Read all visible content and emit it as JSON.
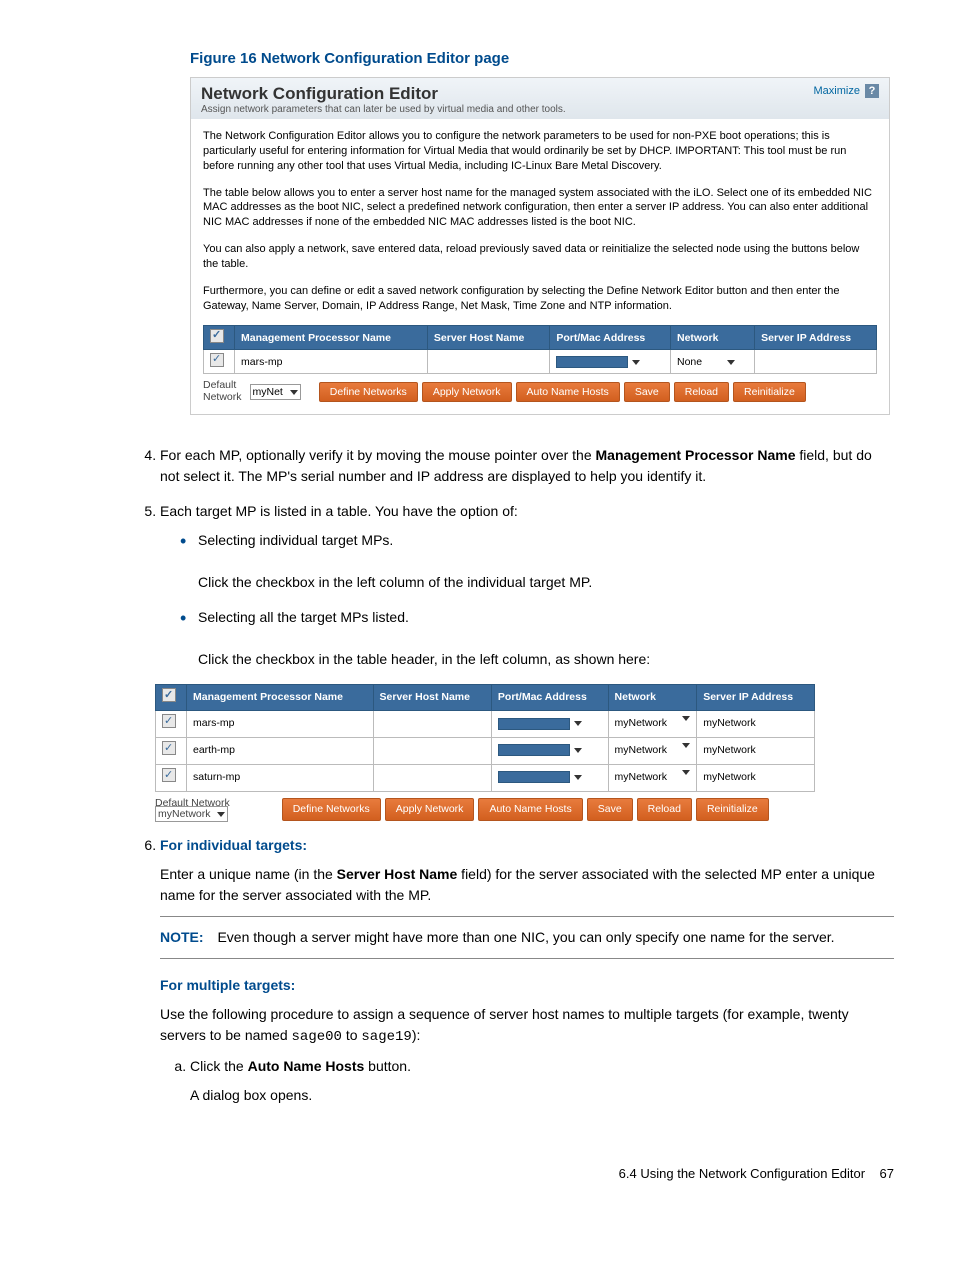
{
  "figure_title": "Figure 16 Network Configuration Editor page",
  "ss1": {
    "title": "Network Configuration Editor",
    "subtitle": "Assign network parameters that can later be used by virtual media and other tools.",
    "maximize": "Maximize",
    "p1": "The Network Configuration Editor allows you to configure the network parameters to be used for non-PXE boot operations; this is particularly useful for entering information for Virtual Media that would ordinarily be set by DHCP. IMPORTANT: This tool must be run before running any other tool that uses Virtual Media, including IC-Linux Bare Metal Discovery.",
    "p2": "The table below allows you to enter a server host name for the managed system associated with the iLO. Select one of its embedded NIC MAC addresses as the boot NIC, select a predefined network configuration, then enter a server IP address. You can also enter additional NIC MAC addresses if none of the embedded NIC MAC addresses listed is the boot NIC.",
    "p3": "You can also apply a network, save entered data, reload previously saved data or reinitialize the selected node using the buttons below the table.",
    "p4": "Furthermore, you can define or edit a saved network configuration by selecting the Define Network Editor button and then enter the Gateway, Name Server, Domain, IP Address Range, Net Mask, Time Zone and NTP information.",
    "headers": [
      "Management Processor Name",
      "Server Host Name",
      "Port/Mac Address",
      "Network",
      "Server IP Address"
    ],
    "row1_name": "mars-mp",
    "row1_network": "None",
    "default_network_label": "Default\nNetwork",
    "default_network_value": "myNet",
    "buttons": [
      "Define Networks",
      "Apply Network",
      "Auto Name Hosts",
      "Save",
      "Reload",
      "Reinitialize"
    ]
  },
  "step4": {
    "pre": "For each MP, optionally verify it by moving the mouse pointer over the ",
    "bold": "Management Processor Name",
    "post": " field, but do not select it. The MP's serial number and IP address are displayed to help you identify it."
  },
  "step5": {
    "intro": "Each target MP is listed in a table. You have the option of:",
    "b1a": "Selecting individual target MPs.",
    "b1b": "Click the checkbox in the left column of the individual target MP.",
    "b2a": "Selecting all the target MPs listed.",
    "b2b": "Click the checkbox in the table header, in the left column, as shown here:"
  },
  "ss2": {
    "headers": [
      "Management Processor Name",
      "Server Host Name",
      "Port/Mac Address",
      "Network",
      "Server IP Address"
    ],
    "rows": [
      {
        "name": "mars-mp",
        "net": "myNetwork",
        "ip": "myNetwork"
      },
      {
        "name": "earth-mp",
        "net": "myNetwork",
        "ip": "myNetwork"
      },
      {
        "name": "saturn-mp",
        "net": "myNetwork",
        "ip": "myNetwork"
      }
    ],
    "default_network_label": "Default Network",
    "default_network_value": "myNetwork",
    "buttons": [
      "Define Networks",
      "Apply Network",
      "Auto Name Hosts",
      "Save",
      "Reload",
      "Reinitialize"
    ]
  },
  "step6": {
    "h1": "For individual targets:",
    "p1a": "Enter a unique name (in the ",
    "p1b": "Server Host Name",
    "p1c": " field) for the server associated with the selected MP enter a unique name for the server associated with the MP.",
    "note_label": "NOTE:",
    "note": "Even though a server might have more than one NIC, you can only specify one name for the server.",
    "h2": "For multiple targets:",
    "p2a": "Use the following procedure to assign a sequence of server host names to multiple targets (for example, twenty servers to be named ",
    "p2b": "sage00",
    "p2c": " to ",
    "p2d": "sage19",
    "p2e": "):",
    "a1a": "Click the ",
    "a1b": "Auto Name Hosts",
    "a1c": " button.",
    "a2": "A dialog box opens."
  },
  "footer": {
    "text": "6.4 Using the Network Configuration Editor",
    "pageno": "67"
  }
}
